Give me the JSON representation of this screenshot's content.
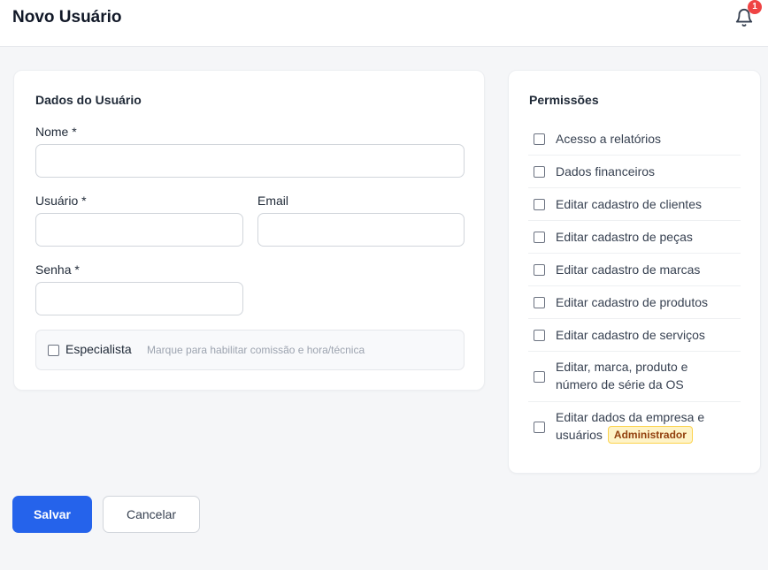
{
  "header": {
    "title": "Novo Usuário",
    "notification_count": "1"
  },
  "user_form": {
    "section_title": "Dados do Usuário",
    "name": {
      "label": "Nome *",
      "value": ""
    },
    "username": {
      "label": "Usuário *",
      "value": ""
    },
    "email": {
      "label": "Email",
      "value": ""
    },
    "password": {
      "label": "Senha *",
      "value": ""
    },
    "specialist": {
      "label": "Especialista",
      "hint": "Marque para habilitar comissão e hora/técnica",
      "checked": false
    }
  },
  "permissions": {
    "section_title": "Permissões",
    "items": [
      {
        "label": "Acesso a relatórios",
        "checked": false
      },
      {
        "label": "Dados financeiros",
        "checked": false
      },
      {
        "label": "Editar cadastro de clientes",
        "checked": false
      },
      {
        "label": "Editar cadastro de peças",
        "checked": false
      },
      {
        "label": "Editar cadastro de marcas",
        "checked": false
      },
      {
        "label": "Editar cadastro de produtos",
        "checked": false
      },
      {
        "label": "Editar cadastro de serviços",
        "checked": false
      },
      {
        "label": "Editar, marca, produto e número de série da OS",
        "checked": false
      },
      {
        "label": "Editar dados da empresa e usuários",
        "checked": false,
        "badge": "Administrador"
      }
    ]
  },
  "actions": {
    "save_label": "Salvar",
    "cancel_label": "Cancelar"
  },
  "colors": {
    "primary": "#2563eb",
    "badge_bg": "#fef3c7",
    "badge_text": "#92400e",
    "notification": "#ef4444"
  },
  "icons": {
    "notification": "bell-icon"
  }
}
